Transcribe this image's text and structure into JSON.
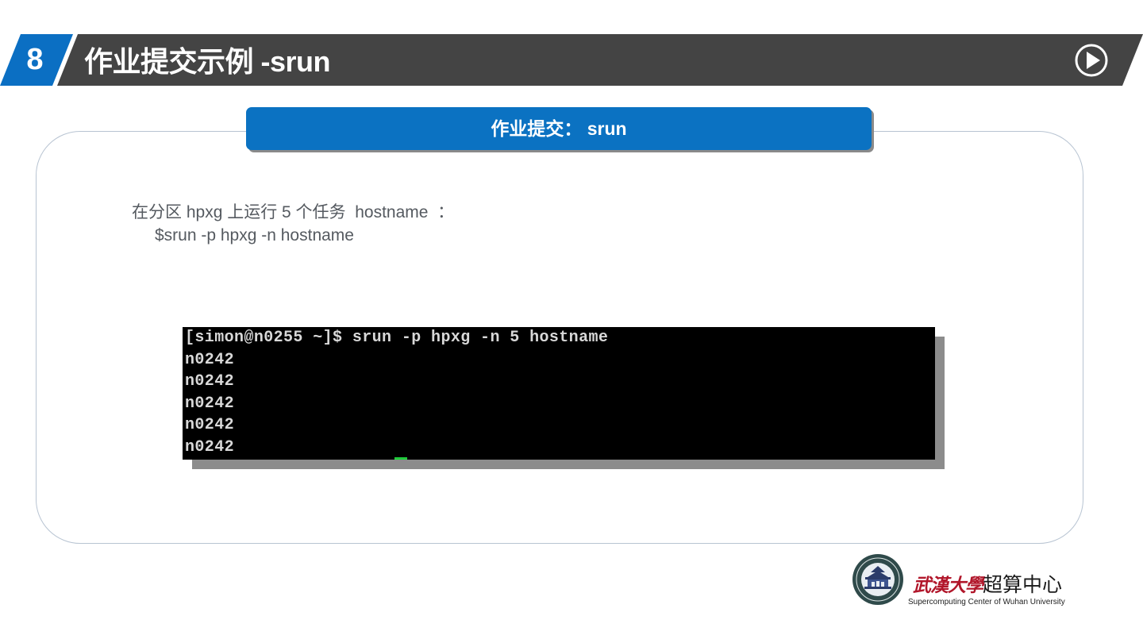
{
  "header": {
    "section_number": "8",
    "title": "作业提交示例 -srun"
  },
  "card": {
    "heading": "作业提交： srun",
    "description_line1": "在分区 hpxg 上运行 5 个任务  hostname  ：",
    "description_line2": "$srun -p hpxg -n hostname"
  },
  "terminal": {
    "lines": [
      "[simon@n0255 ~]$ srun -p hpxg -n 5 hostname",
      "n0242",
      "n0242",
      "n0242",
      "n0242",
      "n0242"
    ]
  },
  "logo": {
    "university_name": "武漢大學",
    "center_name": "超算中心",
    "english_name": "Supercomputing Center of Wuhan University"
  },
  "colors": {
    "accent_blue": "#0b6fc3",
    "header_gray": "#444444",
    "terminal_bg": "#000000",
    "cursor_green": "#1fcc3b",
    "logo_red": "#b1162a"
  },
  "icons": {
    "header_right": "play-circle-icon",
    "footer_seal": "university-seal-icon"
  }
}
